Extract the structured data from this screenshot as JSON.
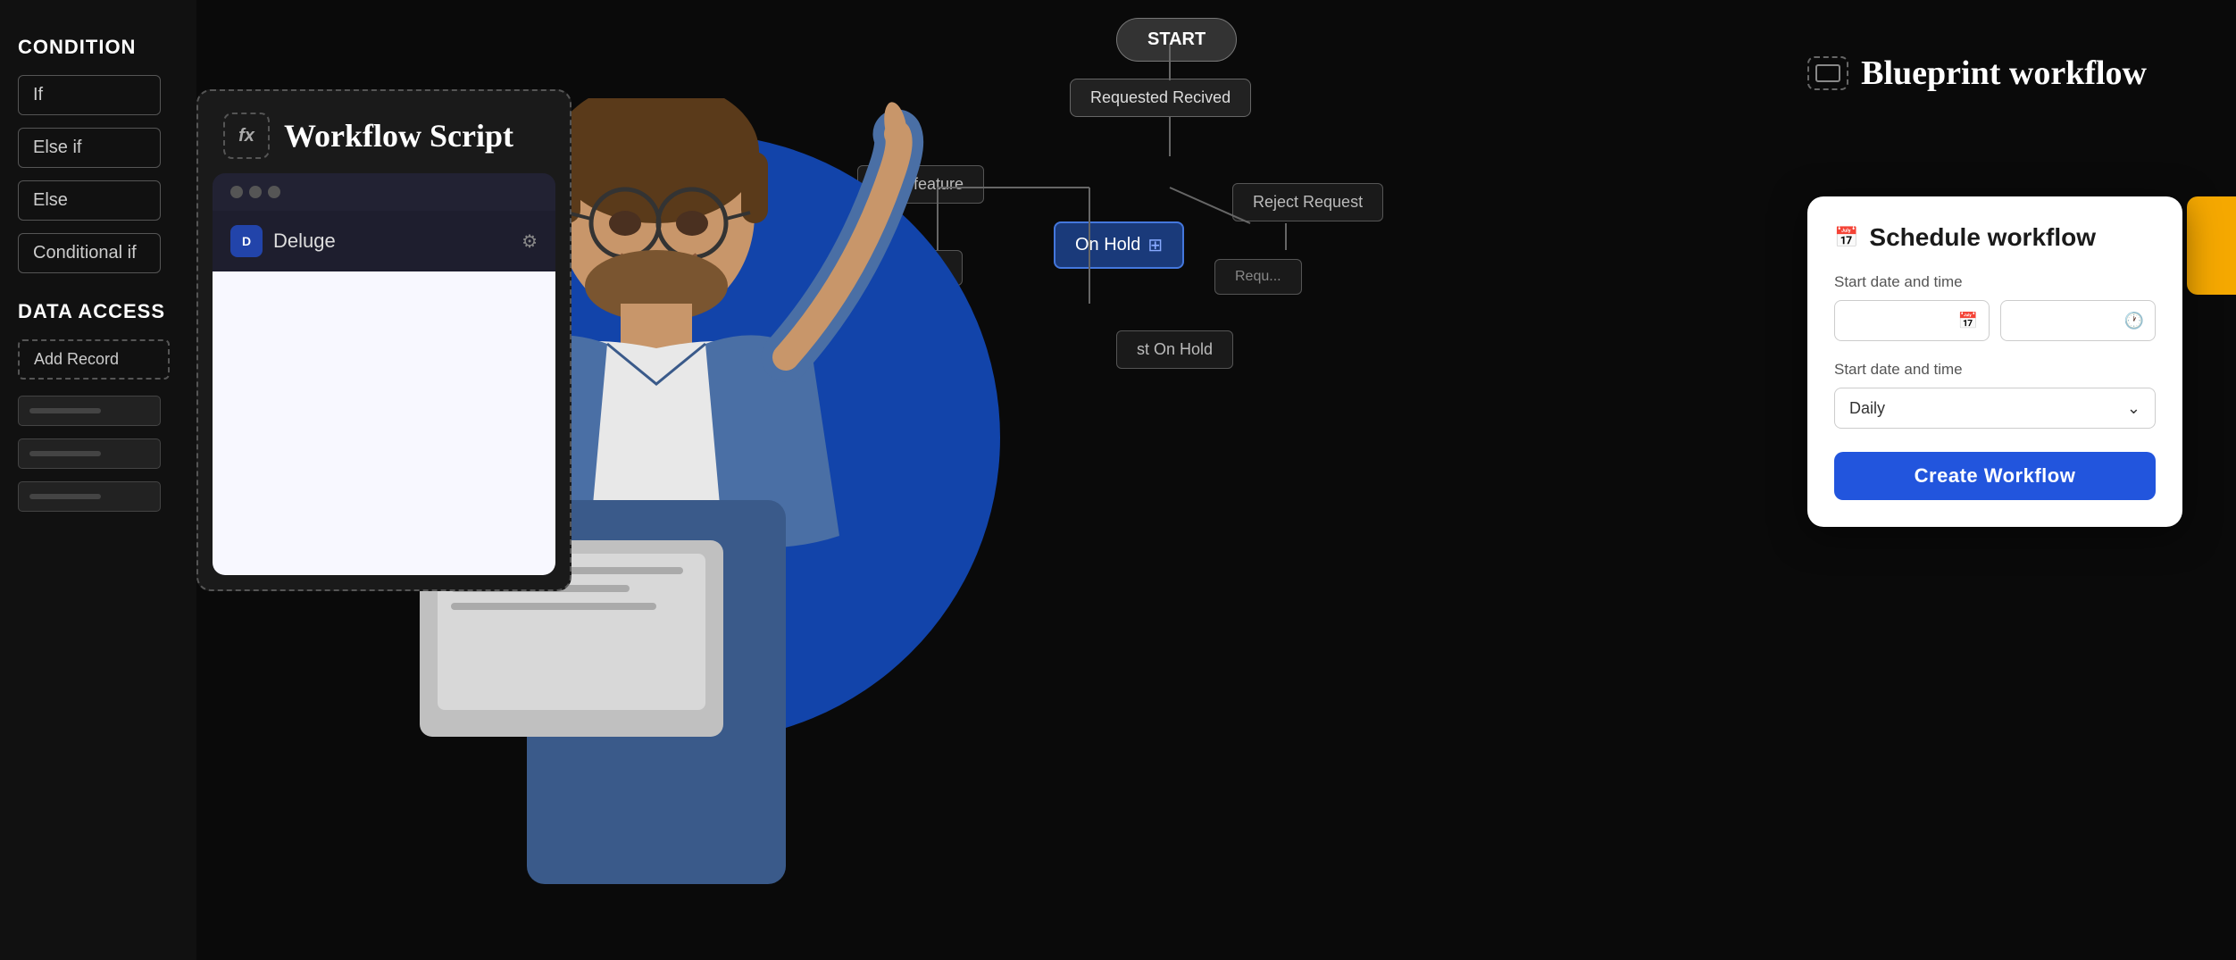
{
  "sidebar": {
    "condition_label": "CONDITION",
    "buttons": [
      "If",
      "Else if",
      "Else",
      "Conditional if"
    ],
    "data_access_label": "DATA ACCESS",
    "add_record_label": "Add Record"
  },
  "workflow_script": {
    "fx_label": "fx",
    "title": "Workflow Script",
    "dots": [
      "dot1",
      "dot2",
      "dot3"
    ],
    "deluge_label": "Deluge"
  },
  "flow": {
    "start_label": "START",
    "requested_received": "Requested Recived",
    "approve_feature": "rove feature",
    "on_hold": "On Hold",
    "reject_request": "Reject Request",
    "request_on_hold": "st On Hold"
  },
  "blueprint": {
    "icon_label": "blueprint-icon",
    "title": "Blueprint workflow"
  },
  "conditional_text": "Conditional",
  "schedule_card": {
    "calendar_icon": "📅",
    "title": "Schedule workflow",
    "start_datetime_label": "Start date and time",
    "date_placeholder": "📅",
    "time_placeholder": "🕐",
    "repeat_label": "Start date and time",
    "repeat_value": "Daily",
    "chevron": "⌄",
    "create_btn_label": "Create Workflow"
  }
}
